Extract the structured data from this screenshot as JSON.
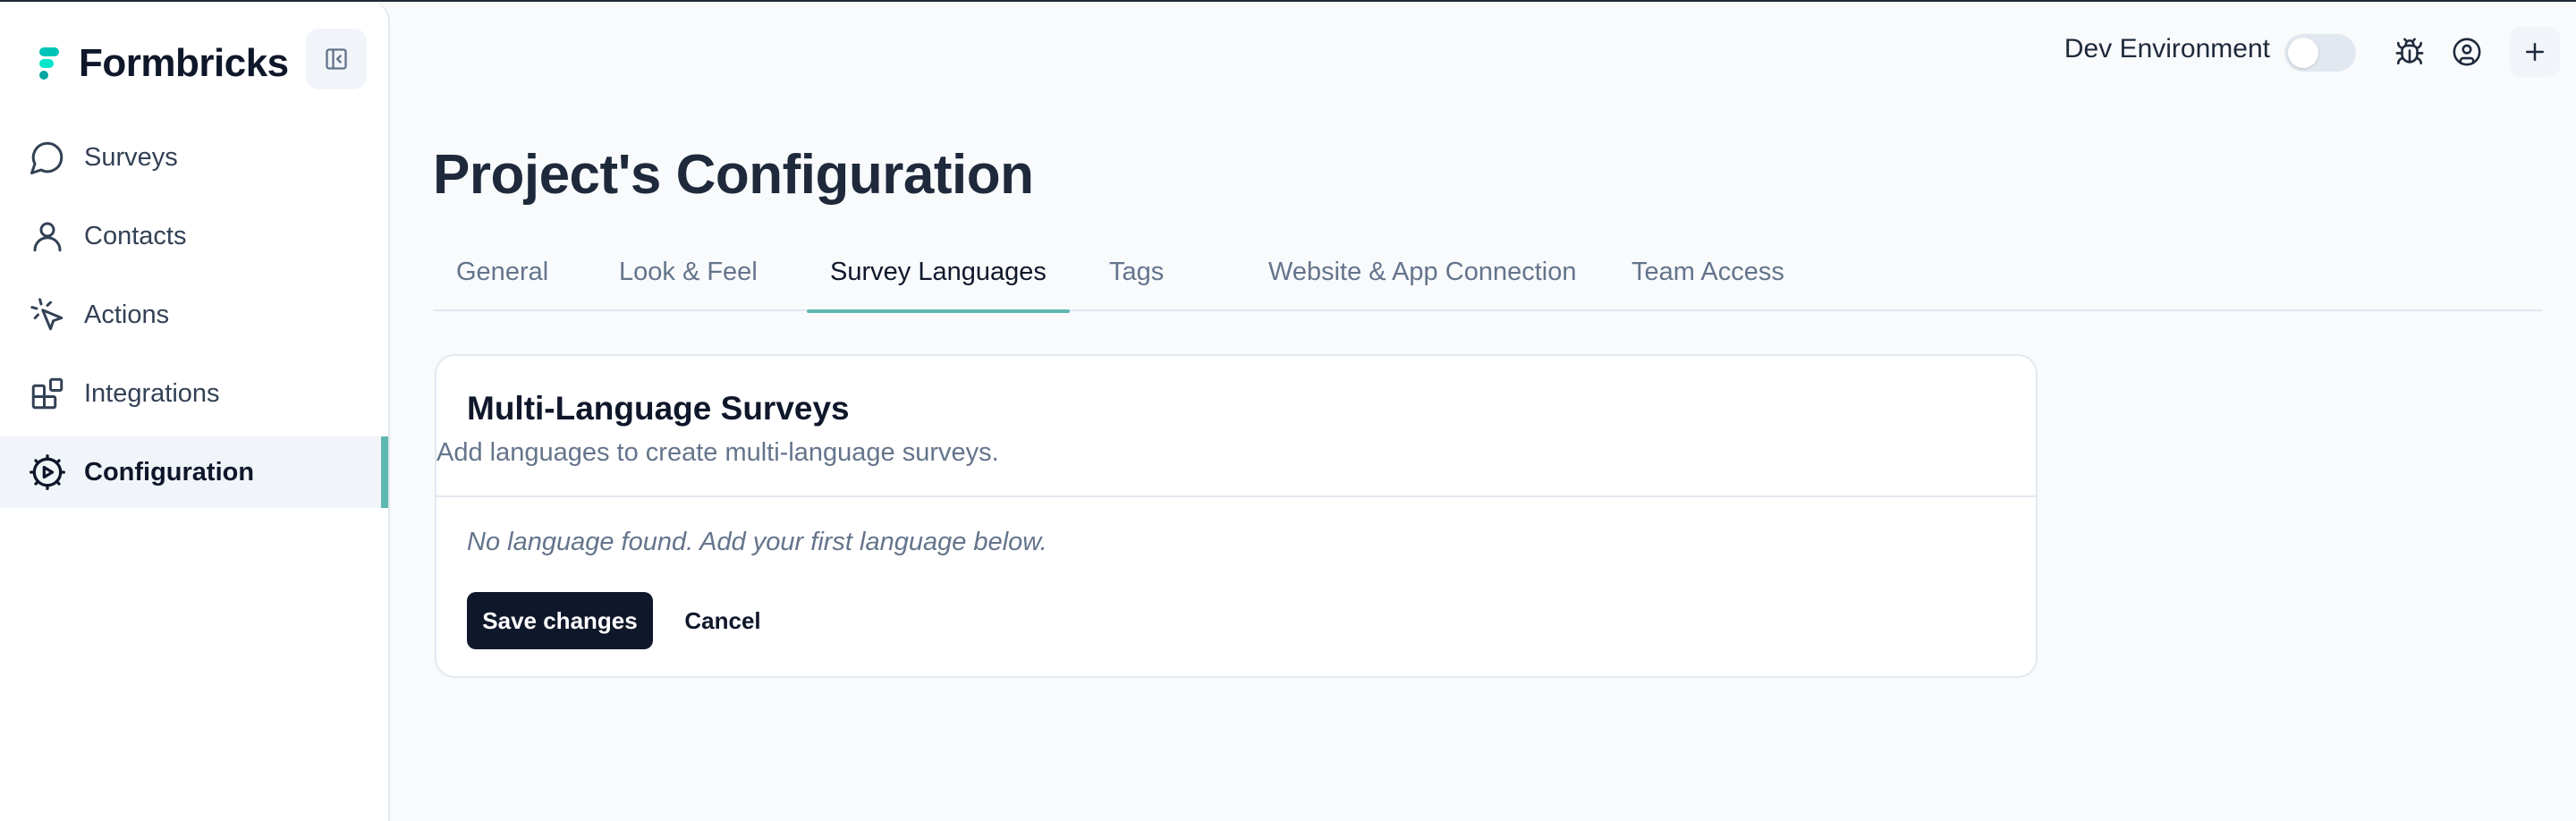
{
  "brand": {
    "name": "Formbricks",
    "accent": "#5fb8b0"
  },
  "sidebar": {
    "items": [
      {
        "label": "Surveys",
        "icon": "message-circle-icon"
      },
      {
        "label": "Contacts",
        "icon": "user-icon"
      },
      {
        "label": "Actions",
        "icon": "cursor-click-icon"
      },
      {
        "label": "Integrations",
        "icon": "blocks-icon"
      },
      {
        "label": "Configuration",
        "icon": "cog-icon",
        "active": true
      }
    ]
  },
  "topbar": {
    "env_label": "Dev Environment",
    "env_toggle_on": false
  },
  "page": {
    "title": "Project's Configuration"
  },
  "tabs": [
    {
      "label": "General"
    },
    {
      "label": "Look & Feel"
    },
    {
      "label": "Survey Languages",
      "active": true
    },
    {
      "label": "Tags"
    },
    {
      "label": "Website & App Connection"
    },
    {
      "label": "Team Access"
    }
  ],
  "card": {
    "title": "Multi-Language Surveys",
    "description": "Add languages to create multi-language surveys.",
    "empty_message": "No language found. Add your first language below.",
    "save_label": "Save changes",
    "cancel_label": "Cancel"
  }
}
